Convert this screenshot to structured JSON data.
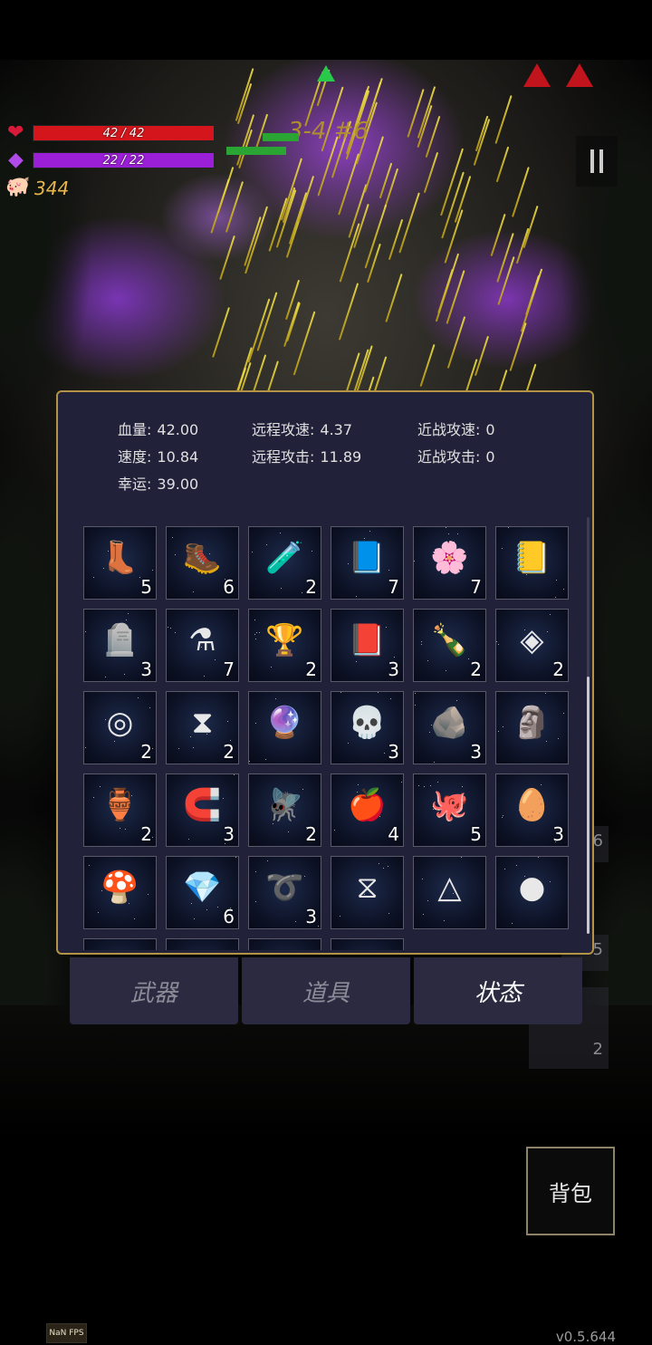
{
  "hud": {
    "health": {
      "current": 42,
      "max": 42,
      "text": "42 / 42",
      "color": "#d4161c"
    },
    "mana": {
      "current": 22,
      "max": 22,
      "text": "22 / 22",
      "color": "#9b1fd6"
    },
    "coins": "344",
    "stage": "3-4 #6",
    "icons": {
      "health": "heart-icon",
      "mana": "mana-crystal-icon",
      "coins": "pig-icon",
      "pause": "pause-icon"
    }
  },
  "stats": [
    {
      "label": "血量:",
      "value": "42.00"
    },
    {
      "label": "远程攻速:",
      "value": "4.37"
    },
    {
      "label": "近战攻速:",
      "value": "0"
    },
    {
      "label": "速度:",
      "value": "10.84"
    },
    {
      "label": "远程攻击:",
      "value": "11.89"
    },
    {
      "label": "近战攻击:",
      "value": "0"
    },
    {
      "label": "幸运:",
      "value": "39.00"
    }
  ],
  "items": [
    {
      "icon": "purple-boots-icon",
      "glyph": "👢",
      "count": "5"
    },
    {
      "icon": "leather-boots-icon",
      "glyph": "🥾",
      "count": "6"
    },
    {
      "icon": "glass-vial-icon",
      "glyph": "🧪",
      "count": "2"
    },
    {
      "icon": "blue-spellbook-icon",
      "glyph": "📘",
      "count": "7"
    },
    {
      "icon": "flower-bunch-icon",
      "glyph": "🌸",
      "count": "7"
    },
    {
      "icon": "rune-book-icon",
      "glyph": "📒",
      "count": ""
    },
    {
      "icon": "tombstone-icon",
      "glyph": "🪦",
      "count": "3"
    },
    {
      "icon": "blue-potion-icon",
      "glyph": "⚗",
      "count": "7"
    },
    {
      "icon": "star-trophy-icon",
      "glyph": "🏆",
      "count": "2"
    },
    {
      "icon": "red-book-icon",
      "glyph": "📕",
      "count": "3"
    },
    {
      "icon": "green-potion-icon",
      "glyph": "🍾",
      "count": "2"
    },
    {
      "icon": "purple-rune-eye-icon",
      "glyph": "◈",
      "count": "2"
    },
    {
      "icon": "purple-rune-spiral-icon",
      "glyph": "◎",
      "count": "2"
    },
    {
      "icon": "yellow-hourglass-card-icon",
      "glyph": "⧗",
      "count": "2"
    },
    {
      "icon": "crystal-orb-icon",
      "glyph": "🔮",
      "count": ""
    },
    {
      "icon": "feather-skull-icon",
      "glyph": "💀",
      "count": "3"
    },
    {
      "icon": "ore-stones-icon",
      "glyph": "🪨",
      "count": "3"
    },
    {
      "icon": "cloak-statue-icon",
      "glyph": "🗿",
      "count": ""
    },
    {
      "icon": "small-bottle-icon",
      "glyph": "🏺",
      "count": "2"
    },
    {
      "icon": "horseshoe-icon",
      "glyph": "🧲",
      "count": "3"
    },
    {
      "icon": "dragonfly-icon",
      "glyph": "🪰",
      "count": "2"
    },
    {
      "icon": "red-apple-icon",
      "glyph": "🍎",
      "count": "4"
    },
    {
      "icon": "octopus-icon",
      "glyph": "🐙",
      "count": "5"
    },
    {
      "icon": "egg-icon",
      "glyph": "🥚",
      "count": "3"
    },
    {
      "icon": "mushroom-icon",
      "glyph": "🍄",
      "count": ""
    },
    {
      "icon": "grey-stone-icon",
      "glyph": "💎",
      "count": "6"
    },
    {
      "icon": "thorn-crown-icon",
      "glyph": "➰",
      "count": "3"
    },
    {
      "icon": "purple-rune-hourglass-icon",
      "glyph": "⧖",
      "count": ""
    },
    {
      "icon": "purple-rune-triangle-icon",
      "glyph": "△",
      "count": ""
    },
    {
      "icon": "rainbow-orb-icon",
      "glyph": "●",
      "count": ""
    }
  ],
  "tabs": [
    {
      "label": "武器",
      "active": false
    },
    {
      "label": "道具",
      "active": false
    },
    {
      "label": "状态",
      "active": true
    }
  ],
  "backpack_label": "背包",
  "fps": "NaN FPS",
  "version": "v0.5.644",
  "side_counts": [
    "6",
    "5",
    "2"
  ],
  "colors": {
    "panel_bg": "#22213a",
    "panel_border": "#b39446",
    "tab_bg": "#2b2a40"
  }
}
